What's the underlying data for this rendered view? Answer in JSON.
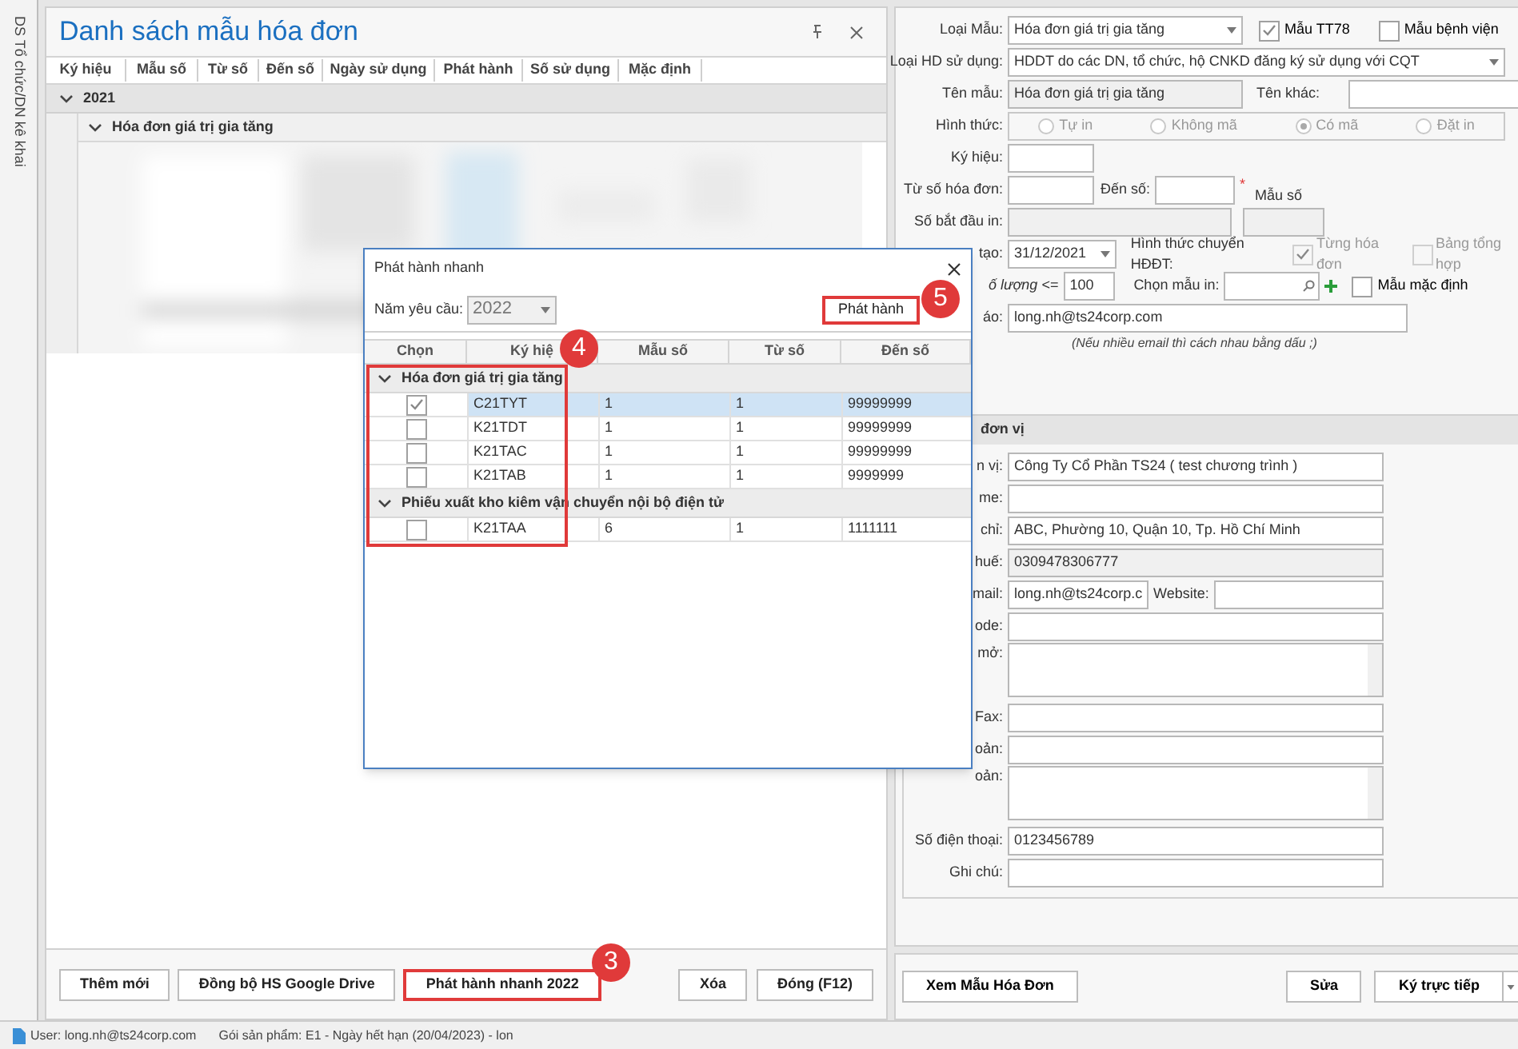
{
  "side_tab": {
    "label": "DS Tổ chức/DN kê khai"
  },
  "list_panel": {
    "title": "Danh sách mẫu hóa đơn",
    "columns": [
      "Ký hiệu",
      "Mẫu số",
      "Từ số",
      "Đến số",
      "Ngày sử dụng",
      "Phát hành",
      "Số sử dụng",
      "Mặc định"
    ],
    "groups": [
      {
        "label": "2021",
        "expanded": true,
        "children": [
          {
            "label": "Hóa đơn giá trị gia tăng",
            "expanded": true
          }
        ]
      }
    ],
    "buttons": [
      {
        "label": "Thêm mới",
        "highlighted": false
      },
      {
        "label": "Đồng bộ HS Google Drive",
        "highlighted": false
      },
      {
        "label": "Phát hành nhanh 2022",
        "highlighted": true,
        "badge": "3"
      },
      {
        "label": "Xóa",
        "highlighted": false
      },
      {
        "label": "Đóng (F12)",
        "highlighted": false
      }
    ]
  },
  "form": {
    "loai_mau": {
      "label": "Loại Mẫu:",
      "value": "Hóa đơn giá trị gia tăng"
    },
    "mau_tt78": {
      "label": "Mẫu TT78",
      "checked": true
    },
    "mau_benh_vien": {
      "label": "Mẫu bệnh viện",
      "checked": false
    },
    "loai_hd": {
      "label": "Loại HD sử dụng:",
      "value": "HDDT do các DN, tổ chức, hộ CNKD đăng ký sử dụng với CQT"
    },
    "ten_mau": {
      "label": "Tên mẫu:",
      "value": "Hóa đơn giá trị gia tăng"
    },
    "ten_khac": {
      "label": "Tên khác:"
    },
    "hinh_thuc": {
      "label": "Hình thức:",
      "options": [
        {
          "label": "Tự in",
          "selected": false
        },
        {
          "label": "Không mã",
          "selected": false
        },
        {
          "label": "Có mã",
          "selected": true
        },
        {
          "label": "Đặt in",
          "selected": false
        }
      ]
    },
    "ky_hieu": {
      "label": "Ký hiệu:"
    },
    "tu_so": {
      "label": "Từ số hóa đơn:"
    },
    "den_so": {
      "label": "Đến số:",
      "required": "*"
    },
    "mau_so": {
      "label": "Mẫu số"
    },
    "so_bat_dau": {
      "label": "Số bắt đầu  in:"
    },
    "ngay_tao": {
      "label": "tạo:",
      "value": "31/12/2021"
    },
    "hinh_thuc_chuyen": {
      "label": "Hình thức chuyển HĐĐT:",
      "options": [
        {
          "label": "Từng hóa đơn",
          "checked": true
        },
        {
          "label": "Bảng tổng hợp",
          "checked": false
        }
      ]
    },
    "so_luong": {
      "label": "ố lượng <=",
      "value": "100"
    },
    "chon_mau_in": {
      "label": "Chọn mẫu in:"
    },
    "mau_mac_dinh": {
      "label": "Mẫu mặc định",
      "checked": false
    },
    "email": {
      "label": "áo:",
      "value": "long.nh@ts24corp.com"
    },
    "email_note": "(Nếu nhiều email thì cách nhau bằng dấu ;)"
  },
  "unit_section": {
    "title": "đơn vị",
    "fields": [
      {
        "label": "n vị:",
        "value": "Công Ty Cổ Phần TS24 ( test chương trình )",
        "kind": "text"
      },
      {
        "label": "me:",
        "kind": "text"
      },
      {
        "label": "chỉ:",
        "value": "ABC, Phường 10, Quận 10, Tp. Hồ Chí Minh",
        "kind": "text"
      },
      {
        "label": "huế:",
        "value": "0309478306777",
        "kind": "readonly"
      },
      {
        "label": "mail:",
        "value": "long.nh@ts24corp.c",
        "kind": "email",
        "extra_label": "Website:"
      },
      {
        "label": "ode:",
        "kind": "text"
      },
      {
        "label": "mở:",
        "kind": "multiline"
      },
      {
        "label": "Fax:",
        "kind": "text"
      },
      {
        "label": "oản:",
        "kind": "text"
      },
      {
        "label": "oản:",
        "kind": "multiline"
      },
      {
        "label": "Số điện thoại:",
        "value": "0123456789",
        "kind": "text"
      },
      {
        "label": "Ghi chú:",
        "kind": "text"
      }
    ]
  },
  "form_buttons": [
    {
      "label": "Xem Mẫu Hóa Đơn",
      "kind": "plain"
    },
    {
      "label": "Sửa",
      "kind": "plain"
    },
    {
      "label": "Ký trực tiếp",
      "kind": "split"
    }
  ],
  "dialog": {
    "title": "Phát hành nhanh",
    "year": {
      "label": "Năm yêu cầu:",
      "value": "2022"
    },
    "issue_button": {
      "label": "Phát hành",
      "badge": "5"
    },
    "columns": [
      "Chọn",
      "Ký hiệ",
      "Mẫu số",
      "Từ số",
      "Đến số"
    ],
    "highlight_badge": "4",
    "groups": [
      {
        "label": "Hóa đơn giá trị gia tăng",
        "expanded": true,
        "rows": [
          {
            "checked": true,
            "selected": true,
            "cells": [
              "C21TYT",
              "1",
              "1",
              "99999999"
            ]
          },
          {
            "checked": false,
            "selected": false,
            "cells": [
              "K21TDT",
              "1",
              "1",
              "99999999"
            ]
          },
          {
            "checked": false,
            "selected": false,
            "cells": [
              "K21TAC",
              "1",
              "1",
              "99999999"
            ]
          },
          {
            "checked": false,
            "selected": false,
            "cells": [
              "K21TAB",
              "1",
              "1",
              "9999999"
            ]
          }
        ]
      },
      {
        "label": "Phiếu xuất kho kiêm vận chuyển nội bộ điện tử",
        "expanded": true,
        "rows": [
          {
            "checked": false,
            "selected": false,
            "cells": [
              "K21TAA",
              "6",
              "1",
              "1111111"
            ]
          }
        ]
      }
    ]
  },
  "status_bar": {
    "user": "User: long.nh@ts24corp.com",
    "product": "Gói sản phẩm: E1 - Ngày hết hạn (20/04/2023) - lon"
  }
}
